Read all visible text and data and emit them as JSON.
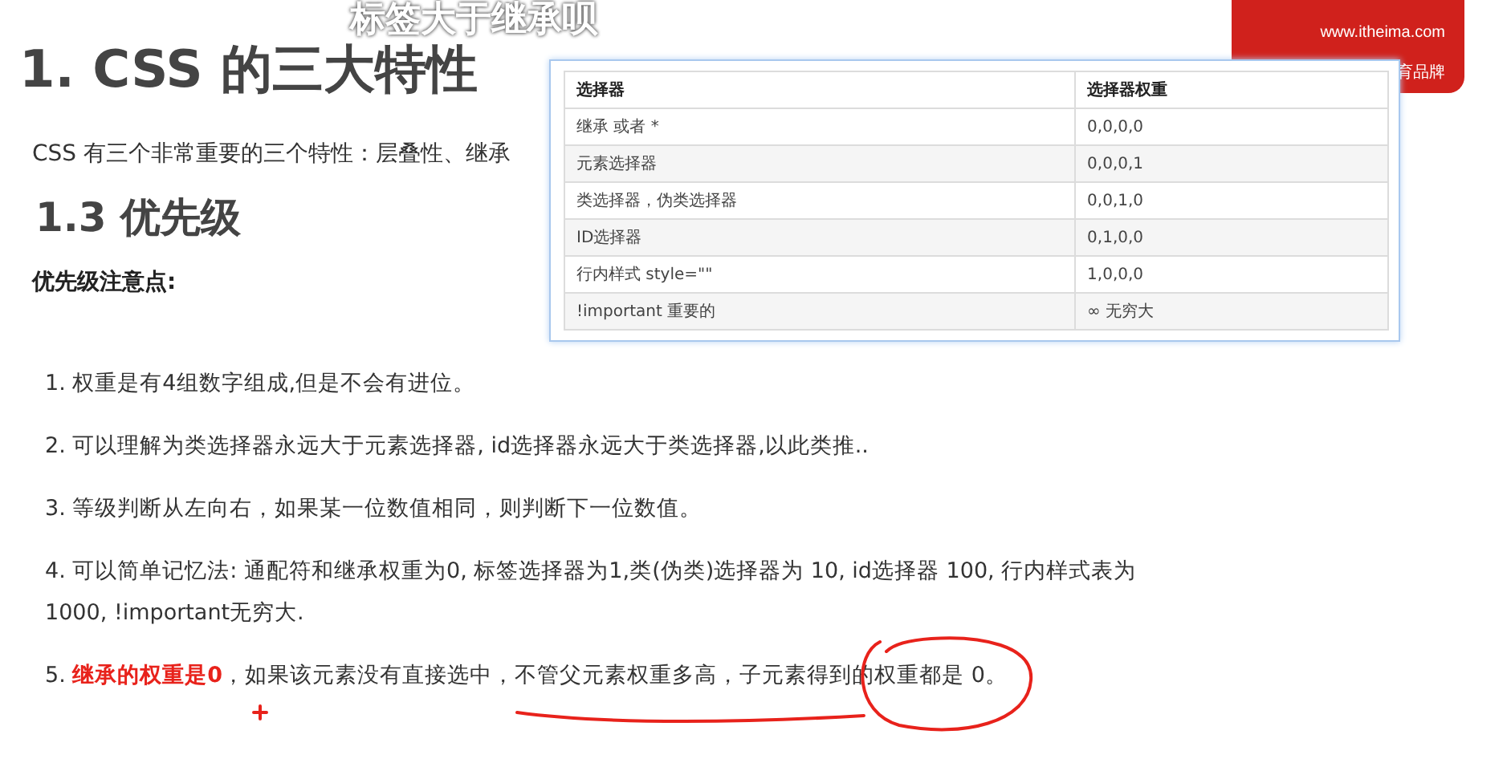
{
  "subtitle": "标签大于继承呗",
  "title": "1. CSS 的三大特性",
  "intro": "CSS 有三个非常重要的三个特性：层叠性、继承",
  "section_title": "1.3 优先级",
  "notes_heading": "优先级注意点:",
  "items": [
    "1. 权重是有4组数字组成,但是不会有进位。",
    "2. 可以理解为类选择器永远大于元素选择器, id选择器永远大于类选择器,以此类推..",
    "3. 等级判断从左向右，如果某一位数值相同，则判断下一位数值。",
    "4. 可以简单记忆法: 通配符和继承权重为0, 标签选择器为1,类(伪类)选择器为 10, id选择器 100, 行内样式表为 1000, !important无穷大.",
    "5. **继承的权重是0**，如果该元素没有直接选中，不管父元素权重多高，子元素得到的权重都是 0。"
  ],
  "logo": {
    "url": "www.itheima.com",
    "tagline": "育品牌"
  },
  "table": {
    "columns": [
      "选择器",
      "选择器权重"
    ],
    "rows": [
      [
        "继承 或者 *",
        "0,0,0,0"
      ],
      [
        "元素选择器",
        "0,0,0,1"
      ],
      [
        "类选择器，伪类选择器",
        "0,0,1,0"
      ],
      [
        "ID选择器",
        "0,1,0,0"
      ],
      [
        "行内样式 style=\"\"",
        "1,0,0,0"
      ],
      [
        "!important  重要的",
        "∞ 无穷大"
      ]
    ]
  }
}
